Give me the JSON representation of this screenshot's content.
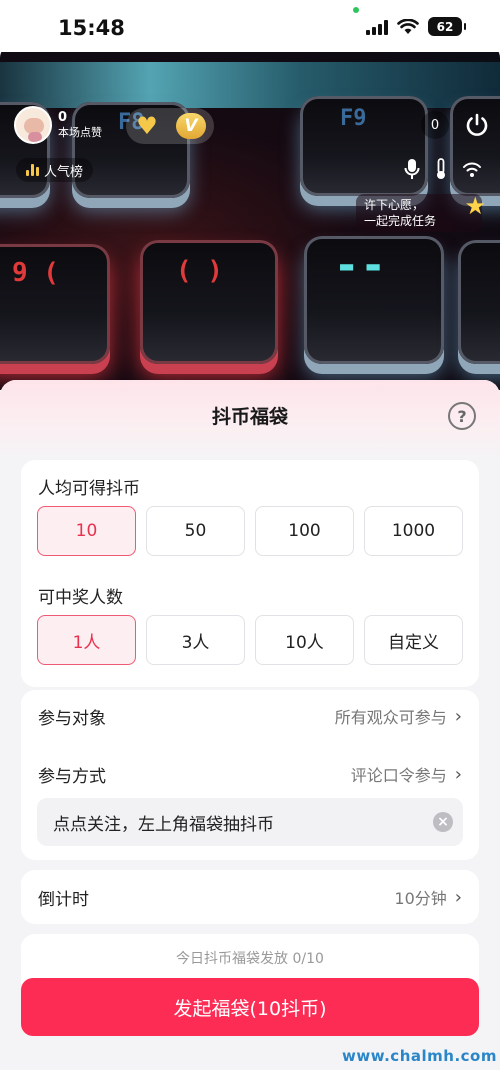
{
  "status_bar": {
    "time": "15:48",
    "battery": "62"
  },
  "live": {
    "host_likes": "0",
    "host_likes_label": "本场点赞",
    "rank_label": "人气榜",
    "viewer_count": "0",
    "wish_line1": "许下心愿，",
    "wish_line2": "一起完成任务",
    "key_labels": [
      "F8",
      "F9",
      "9 (",
      "( )"
    ]
  },
  "sheet": {
    "title": "抖币福袋",
    "help_icon": "?",
    "coins_label": "人均可得抖币",
    "coin_options": [
      "10",
      "50",
      "100",
      "1000"
    ],
    "coin_selected": "10",
    "winners_label": "可中奖人数",
    "winner_options": [
      "1人",
      "3人",
      "10人",
      "自定义"
    ],
    "winner_selected": "1人",
    "participants_label": "参与对象",
    "participants_value": "所有观众可参与",
    "method_label": "参与方式",
    "method_value": "评论口令参与",
    "command_text": "点点关注，左上角福袋抽抖币",
    "countdown_label": "倒计时",
    "countdown_value": "10分钟",
    "daily_quota": "今日抖币福袋发放 0/10",
    "launch_button": "发起福袋(10抖币)"
  },
  "watermark": "www.chalmh.com",
  "colors": {
    "accent": "#fc2c55",
    "selected_border": "#ee5a73",
    "selected_text": "#e8314f"
  }
}
